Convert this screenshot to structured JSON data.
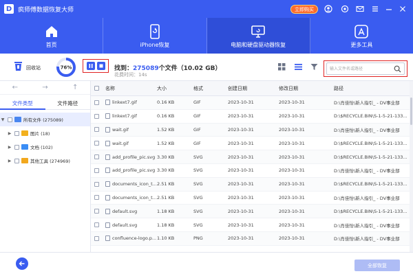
{
  "app": {
    "logo_letter": "D",
    "title": "疯师傅数据恢复大师",
    "buy_label": "立即购买"
  },
  "nav": {
    "items": [
      {
        "label": "首页",
        "icon": "home-icon"
      },
      {
        "label": "iPhone恢复",
        "icon": "phone-icon"
      },
      {
        "label": "电脑和硬盘驱动器恢复",
        "icon": "monitor-icon"
      },
      {
        "label": "更多工具",
        "icon": "app-store-icon"
      }
    ],
    "active_index": 2
  },
  "toolbar": {
    "recycle_label": "回收站",
    "progress_text": "76%",
    "progress": 0.76,
    "found_prefix": "找到：",
    "found_count": "275089",
    "found_suffix": "个文件（10.02 GB）",
    "time_text": "花费时间：14s",
    "search_placeholder": "输入文件名或路径"
  },
  "sidebar": {
    "tabs": [
      "文件类型",
      "文件路径"
    ],
    "active_tab": 0,
    "tree": [
      {
        "label": "所有文件 (275089)",
        "color": "#4a86f0"
      },
      {
        "label": "图片 (18)",
        "color": "#f2b01e"
      },
      {
        "label": "文档 (102)",
        "color": "#3a8df5"
      },
      {
        "label": "其他工具 (274969)",
        "color": "#f2a81e"
      }
    ]
  },
  "table": {
    "headers": [
      "名称",
      "大小",
      "格式",
      "创建日期",
      "修改日期",
      "路径"
    ],
    "rows": [
      {
        "name": "linkext7.gif",
        "size": "0.16 KB",
        "format": "GIF",
        "created": "2023-10-31",
        "modified": "2023-10-31",
        "path": "D:\\肖佳怡\\新人指引_ - DV事业部"
      },
      {
        "name": "linkext7.gif",
        "size": "0.16 KB",
        "format": "GIF",
        "created": "2023-10-31",
        "modified": "2023-10-31",
        "path": "D:\\$RECYCLE.BIN\\S-1-5-21-133..."
      },
      {
        "name": "wait.gif",
        "size": "1.52 KB",
        "format": "GIF",
        "created": "2023-10-31",
        "modified": "2023-10-31",
        "path": "D:\\肖佳怡\\新人指引_ - DV事业部"
      },
      {
        "name": "wait.gif",
        "size": "1.52 KB",
        "format": "GIF",
        "created": "2023-10-31",
        "modified": "2023-10-31",
        "path": "D:\\$RECYCLE.BIN\\S-1-5-21-133..."
      },
      {
        "name": "add_profile_pic.svg",
        "size": "3.30 KB",
        "format": "SVG",
        "created": "2023-10-31",
        "modified": "2023-10-31",
        "path": "D:\\$RECYCLE.BIN\\S-1-5-21-133..."
      },
      {
        "name": "add_profile_pic.svg",
        "size": "3.30 KB",
        "format": "SVG",
        "created": "2023-10-31",
        "modified": "2023-10-31",
        "path": "D:\\肖佳怡\\新人指引_ - DV事业部"
      },
      {
        "name": "documents_icon_t...",
        "size": "2.51 KB",
        "format": "SVG",
        "created": "2023-10-31",
        "modified": "2023-10-31",
        "path": "D:\\$RECYCLE.BIN\\S-1-5-21-133..."
      },
      {
        "name": "documents_icon_t...",
        "size": "2.51 KB",
        "format": "SVG",
        "created": "2023-10-31",
        "modified": "2023-10-31",
        "path": "D:\\肖佳怡\\新人指引_ - DV事业部"
      },
      {
        "name": "default.svg",
        "size": "1.18 KB",
        "format": "SVG",
        "created": "2023-10-31",
        "modified": "2023-10-31",
        "path": "D:\\$RECYCLE.BIN\\S-1-5-21-133..."
      },
      {
        "name": "default.svg",
        "size": "1.18 KB",
        "format": "SVG",
        "created": "2023-10-31",
        "modified": "2023-10-31",
        "path": "D:\\肖佳怡\\新人指引_ - DV事业部"
      },
      {
        "name": "confluence-logo.p...",
        "size": "1.10 KB",
        "format": "PNG",
        "created": "2023-10-31",
        "modified": "2023-10-31",
        "path": "D:\\肖佳怡\\新人指引_ - DV事业部"
      }
    ]
  },
  "bottom": {
    "recover_label": "全部恢复"
  },
  "colors": {
    "brand": "#3a5cf0",
    "highlight_outline": "#e02020",
    "buy_button": "#ff6b2c"
  }
}
